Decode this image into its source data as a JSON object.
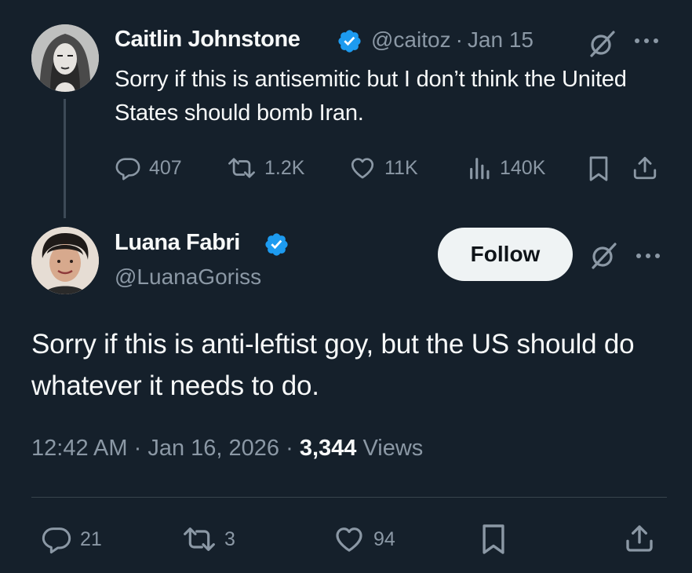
{
  "parent_tweet": {
    "display_name": "Caitlin Johnstone",
    "handle": "@caitoz",
    "separator": "·",
    "date": "Jan 15",
    "text": "Sorry if this is antisemitic but I don’t think the United States should bomb Iran.",
    "stats": {
      "replies": "407",
      "retweets": "1.2K",
      "likes": "11K",
      "views": "140K"
    }
  },
  "main_tweet": {
    "display_name": "Luana Fabri",
    "handle": "@LuanaGoriss",
    "follow_label": "Follow",
    "text": "Sorry if this is anti-leftist goy, but the US should do whatever it needs to do.",
    "time": "12:42 AM",
    "separator": "·",
    "date": "Jan 16, 2026",
    "views_count": "3,344",
    "views_label": "Views",
    "stats": {
      "replies": "21",
      "retweets": "3",
      "likes": "94"
    }
  },
  "colors": {
    "background": "#15202b",
    "text_primary": "#f7f9f9",
    "text_muted": "#8b98a5",
    "verified_blue": "#1d9bf0",
    "divider": "#38444d",
    "follow_button_bg": "#eff3f4"
  },
  "icons": {
    "verified": "verified-badge-icon",
    "grok": "grok-icon",
    "more": "more-icon",
    "reply": "reply-icon",
    "retweet": "retweet-icon",
    "like": "heart-icon",
    "views": "views-icon",
    "bookmark": "bookmark-icon",
    "share": "share-icon"
  }
}
